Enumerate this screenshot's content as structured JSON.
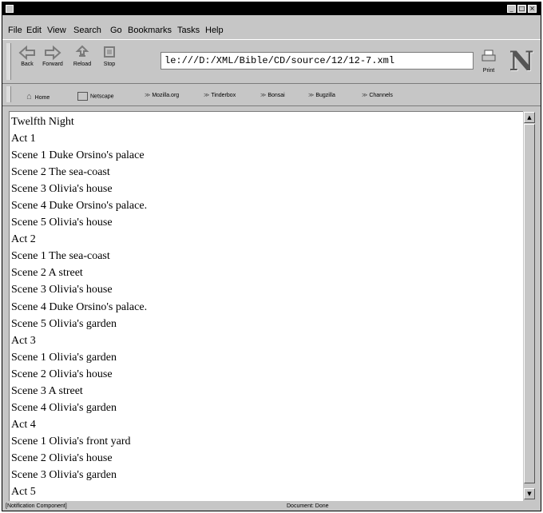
{
  "window": {
    "controls": {
      "minimize": "_",
      "maximize": "□",
      "close": "×"
    }
  },
  "menu": [
    "File",
    "Edit",
    "View",
    "Search",
    "Go",
    "Bookmarks",
    "Tasks",
    "Help"
  ],
  "toolbar": {
    "back": "Back",
    "forward": "Forward",
    "reload": "Reload",
    "stop": "Stop",
    "url": "le:///D:/XML/Bible/CD/source/12/12-7.xml",
    "print": "Print",
    "logo": "N"
  },
  "personal_toolbar": [
    "Home",
    "Netscape",
    "Mozilla.org",
    "Tinderbox",
    "Bonsai",
    "Bugzilla",
    "Channels"
  ],
  "document": {
    "lines": [
      "Twelfth Night",
      "Act 1",
      "Scene 1 Duke Orsino's palace",
      "Scene 2 The sea-coast",
      "Scene 3 Olivia's house",
      "Scene 4 Duke Orsino's palace.",
      "Scene 5 Olivia's house",
      "Act 2",
      "Scene 1 The sea-coast",
      "Scene 2 A street",
      "Scene 3 Olivia's house",
      "Scene 4 Duke Orsino's palace.",
      "Scene 5 Olivia's garden",
      "Act 3",
      "Scene 1 Olivia's garden",
      "Scene 2 Olivia's house",
      "Scene 3 A street",
      "Scene 4 Olivia's garden",
      "Act 4",
      "Scene 1 Olivia's front yard",
      "Scene 2 Olivia's house",
      "Scene 3 Olivia's garden",
      "Act 5"
    ]
  },
  "scrollbar": {
    "up": "▲",
    "down": "▼"
  },
  "status": {
    "left": "[Notification Component]",
    "center": "Document: Done"
  },
  "colors": {
    "chrome": "#c6c6c6",
    "titlebar": "#000000",
    "content": "#ffffff"
  }
}
